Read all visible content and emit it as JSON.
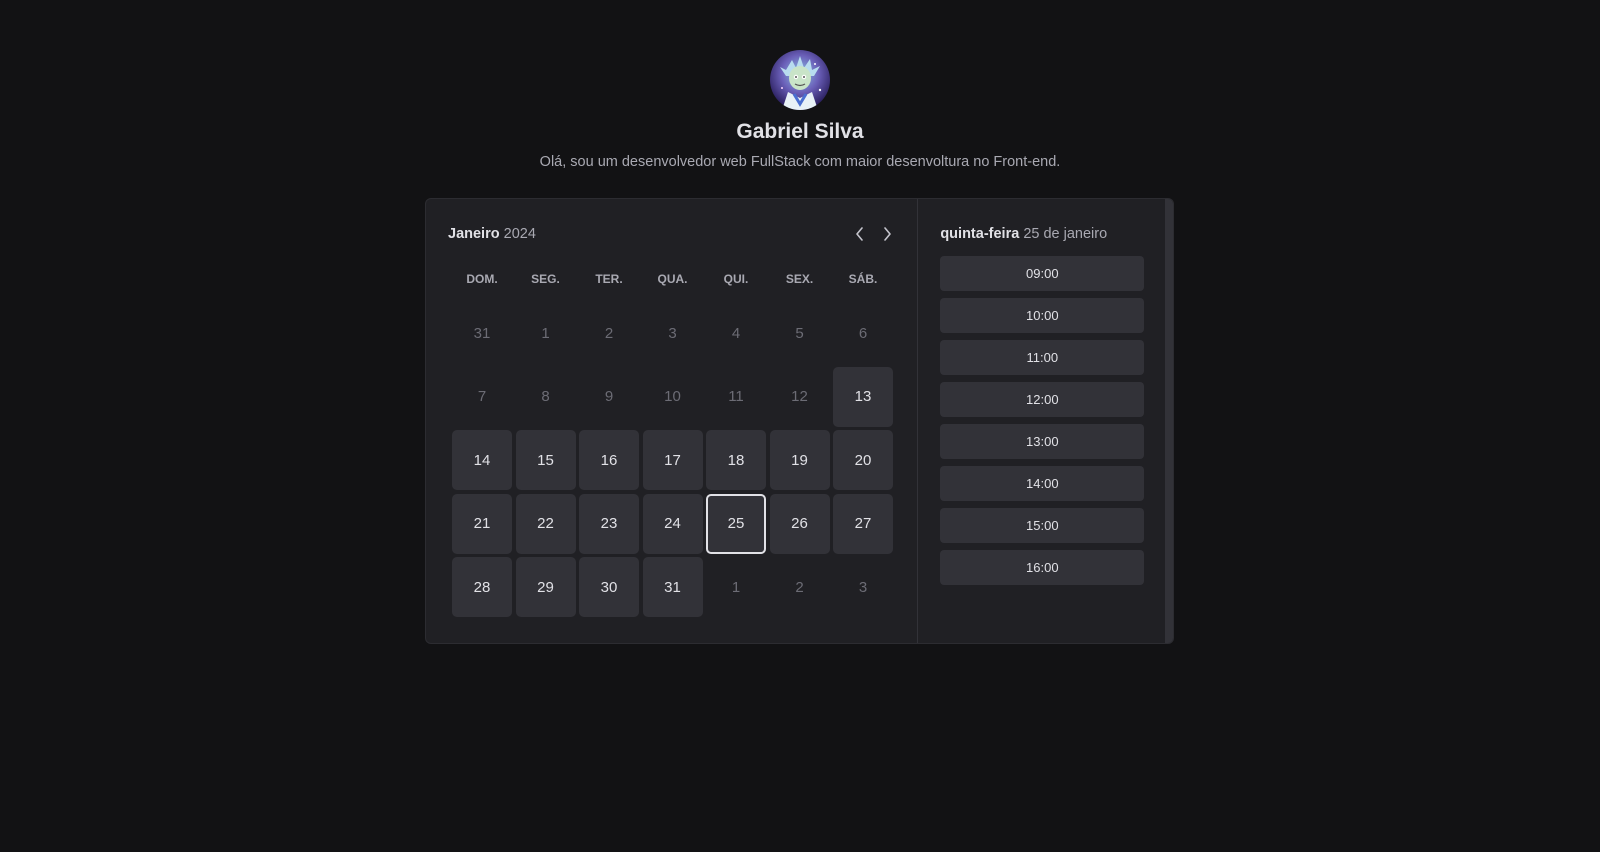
{
  "profile": {
    "name": "Gabriel Silva",
    "bio": "Olá, sou um desenvolvedor web FullStack com maior desenvoltura no Front-end."
  },
  "calendar": {
    "month": "Janeiro",
    "year": "2024",
    "weekdays": [
      "DOM.",
      "SEG.",
      "TER.",
      "QUA.",
      "QUI.",
      "SEX.",
      "SÁB."
    ],
    "days": [
      {
        "label": "31",
        "state": "disabled"
      },
      {
        "label": "1",
        "state": "disabled"
      },
      {
        "label": "2",
        "state": "disabled"
      },
      {
        "label": "3",
        "state": "disabled"
      },
      {
        "label": "4",
        "state": "disabled"
      },
      {
        "label": "5",
        "state": "disabled"
      },
      {
        "label": "6",
        "state": "disabled"
      },
      {
        "label": "7",
        "state": "disabled"
      },
      {
        "label": "8",
        "state": "disabled"
      },
      {
        "label": "9",
        "state": "disabled"
      },
      {
        "label": "10",
        "state": "disabled"
      },
      {
        "label": "11",
        "state": "disabled"
      },
      {
        "label": "12",
        "state": "disabled"
      },
      {
        "label": "13",
        "state": "available"
      },
      {
        "label": "14",
        "state": "available"
      },
      {
        "label": "15",
        "state": "available"
      },
      {
        "label": "16",
        "state": "available"
      },
      {
        "label": "17",
        "state": "available"
      },
      {
        "label": "18",
        "state": "available"
      },
      {
        "label": "19",
        "state": "available"
      },
      {
        "label": "20",
        "state": "available"
      },
      {
        "label": "21",
        "state": "available"
      },
      {
        "label": "22",
        "state": "available"
      },
      {
        "label": "23",
        "state": "available"
      },
      {
        "label": "24",
        "state": "available"
      },
      {
        "label": "25",
        "state": "selected"
      },
      {
        "label": "26",
        "state": "available"
      },
      {
        "label": "27",
        "state": "available"
      },
      {
        "label": "28",
        "state": "available"
      },
      {
        "label": "29",
        "state": "available"
      },
      {
        "label": "30",
        "state": "available"
      },
      {
        "label": "31",
        "state": "available"
      },
      {
        "label": "1",
        "state": "disabled"
      },
      {
        "label": "2",
        "state": "disabled"
      },
      {
        "label": "3",
        "state": "disabled"
      }
    ]
  },
  "times_panel": {
    "weekday": "quinta-feira",
    "date": "25 de janeiro",
    "slots": [
      "09:00",
      "10:00",
      "11:00",
      "12:00",
      "13:00",
      "14:00",
      "15:00",
      "16:00"
    ]
  },
  "icons": {
    "prev": "chevron-left-icon",
    "next": "chevron-right-icon"
  },
  "colors": {
    "background": "#121214",
    "card": "#202024",
    "day_available": "#323238",
    "text_primary": "#e1e1e6",
    "text_secondary": "#a9a9b2",
    "text_disabled": "#6c6c75"
  }
}
